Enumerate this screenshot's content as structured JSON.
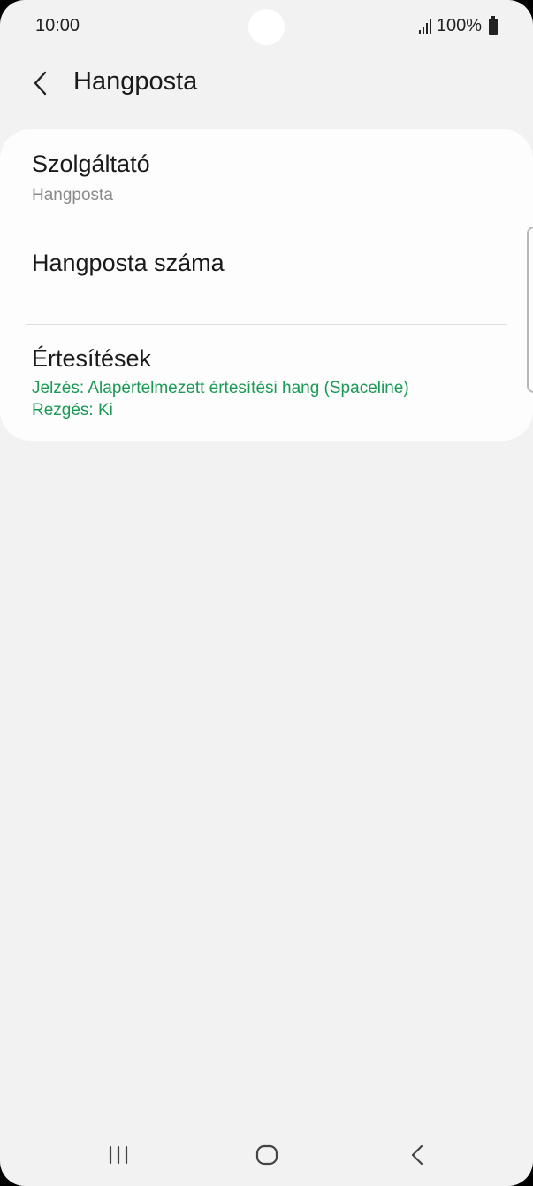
{
  "status_bar": {
    "time": "10:00",
    "battery": "100%"
  },
  "header": {
    "title": "Hangposta"
  },
  "settings": {
    "items": [
      {
        "title": "Szolgáltató",
        "subtitle": "Hangposta"
      },
      {
        "title": "Hangposta száma"
      },
      {
        "title": "Értesítések",
        "lines": [
          "Jelzés: Alapértelmezett értesítési hang (Spaceline)",
          "Rezgés: Ki"
        ]
      }
    ]
  },
  "colors": {
    "background": "#f2f2f2",
    "card": "#fdfdfd",
    "accent_green": "#1a9a55",
    "secondary_text": "#8a8a8a"
  },
  "icons": {
    "back": "chevron-left-icon",
    "signal": "signal-icon",
    "battery": "battery-icon",
    "nav_recents": "recents-icon",
    "nav_home": "home-icon",
    "nav_back": "back-icon"
  }
}
